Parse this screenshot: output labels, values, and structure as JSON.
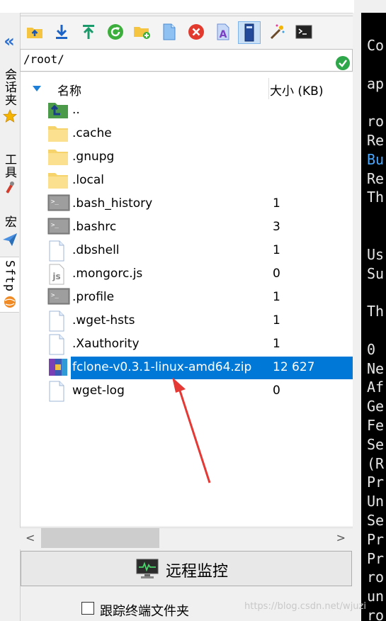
{
  "sidebar": {
    "tabs": [
      {
        "label": "会话夹"
      },
      {
        "label": "工具"
      },
      {
        "label": "宏"
      },
      {
        "label": "Sftp"
      }
    ]
  },
  "path": {
    "value": "/root/"
  },
  "list": {
    "header": {
      "name": "名称",
      "size": "大小 (KB)"
    },
    "rows": [
      {
        "name": "..",
        "size": "",
        "icon": "parent-folder-icon"
      },
      {
        "name": ".cache",
        "size": "",
        "icon": "folder-icon"
      },
      {
        "name": ".gnupg",
        "size": "",
        "icon": "folder-icon"
      },
      {
        "name": ".local",
        "size": "",
        "icon": "folder-icon"
      },
      {
        "name": ".bash_history",
        "size": "1",
        "icon": "shell-file-icon"
      },
      {
        "name": ".bashrc",
        "size": "3",
        "icon": "shell-file-icon"
      },
      {
        "name": ".dbshell",
        "size": "1",
        "icon": "file-icon"
      },
      {
        "name": ".mongorc.js",
        "size": "0",
        "icon": "js-file-icon"
      },
      {
        "name": ".profile",
        "size": "1",
        "icon": "shell-file-icon"
      },
      {
        "name": ".wget-hsts",
        "size": "1",
        "icon": "file-icon"
      },
      {
        "name": ".Xauthority",
        "size": "1",
        "icon": "file-icon"
      },
      {
        "name": "fclone-v0.3.1-linux-amd64.zip",
        "size": "12 627",
        "icon": "archive-icon",
        "selected": true
      },
      {
        "name": "wget-log",
        "size": "0",
        "icon": "file-icon"
      }
    ]
  },
  "monitor": {
    "label": "远程监控"
  },
  "follow": {
    "label": "跟踪终端文件夹",
    "checked": false
  },
  "terminal": {
    "lines": [
      "Co",
      "",
      "ap",
      "",
      "ro",
      "Re",
      "Bu",
      "Re",
      "Th",
      "",
      "",
      "Us",
      "Su",
      "",
      "Th",
      "",
      "0",
      "Ne",
      "Af",
      "Ge",
      "Fe",
      "Se",
      "(R",
      "Pr",
      "Un",
      "Se",
      "Pr",
      "Pr",
      "ro",
      "un",
      "ro"
    ]
  },
  "watermark": {
    "text": "https://blog.csdn.net/wjuzi"
  },
  "colors": {
    "selection": "#0078d7",
    "accent": "#2a6fd4",
    "terminal_bg": "#000000"
  }
}
